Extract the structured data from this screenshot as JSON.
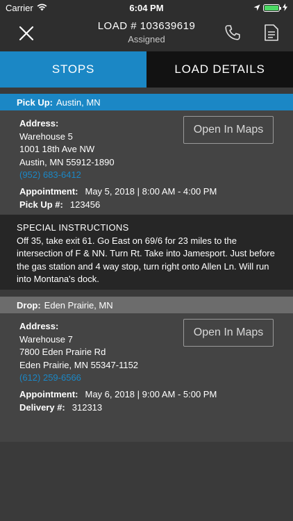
{
  "status_bar": {
    "carrier": "Carrier",
    "time": "6:04 PM",
    "battery_level": 1.0,
    "battery_color": "#4cd964"
  },
  "nav": {
    "title": "LOAD # 103639619",
    "subtitle": "Assigned",
    "close_icon": "close-icon",
    "phone_icon": "phone-icon",
    "doc_icon": "document-icon"
  },
  "tabs": [
    {
      "label": "STOPS",
      "active": true
    },
    {
      "label": "LOAD DETAILS",
      "active": false
    }
  ],
  "colors": {
    "accent": "#1b87c5",
    "drop_header": "#6c6c6c",
    "background": "#3a3a3a"
  },
  "pickup": {
    "header_label": "Pick Up:",
    "header_value": "Austin, MN",
    "address_label": "Address:",
    "address_line1": "Warehouse 5",
    "address_line2": "1001 18th Ave NW",
    "address_line3": "Austin, MN 55912-1890",
    "phone": "(952) 683-6412",
    "maps_button": "Open In Maps",
    "appointment_label": "Appointment:",
    "appointment_value": "May 5, 2018 | 8:00 AM - 4:00 PM",
    "ref_label": "Pick Up #:",
    "ref_value": "123456"
  },
  "special_instructions": {
    "title": "SPECIAL INSTRUCTIONS",
    "text": "Off 35, take exit 61. Go East on 69/6 for 23 miles to the intersection of F & NN. Turn Rt. Take into Jamesport. Just before the gas station and 4 way stop, turn right onto Allen Ln. Will run into Montana's dock."
  },
  "drop": {
    "header_label": "Drop:",
    "header_value": "Eden Prairie, MN",
    "address_label": "Address:",
    "address_line1": "Warehouse 7",
    "address_line2": "7800 Eden Prairie Rd",
    "address_line3": "Eden Prairie, MN 55347-1152",
    "phone": "(612) 259-6566",
    "maps_button": "Open In Maps",
    "appointment_label": "Appointment:",
    "appointment_value": "May 6, 2018 | 9:00 AM - 5:00 PM",
    "ref_label": "Delivery #:",
    "ref_value": "312313"
  }
}
